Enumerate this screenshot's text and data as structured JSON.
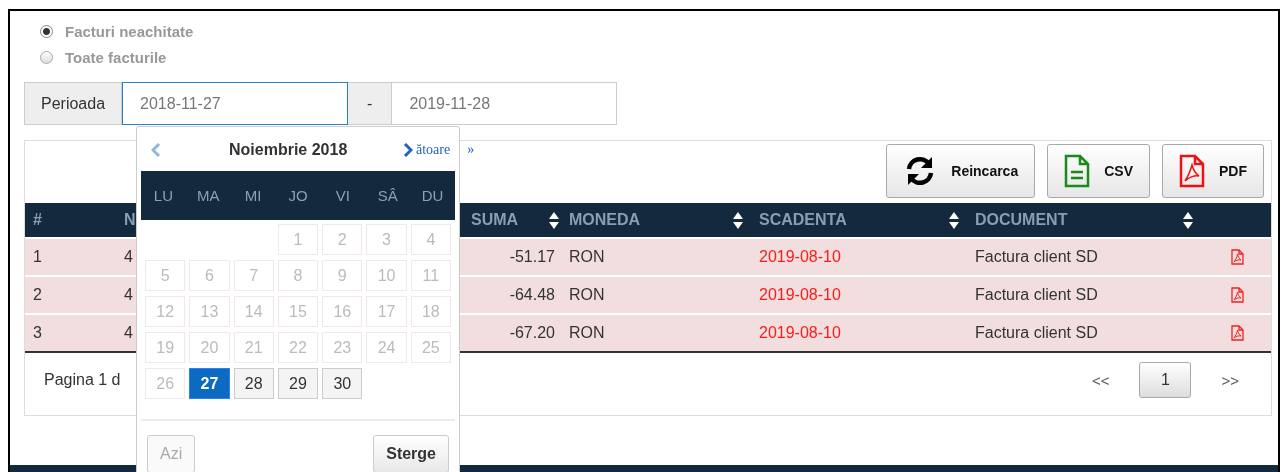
{
  "filter": {
    "options": [
      {
        "label": "Facturi neachitate",
        "selected": true
      },
      {
        "label": "Toate facturile",
        "selected": false
      }
    ]
  },
  "period": {
    "label": "Perioada",
    "from": "2018-11-27",
    "separator": "-",
    "to": "2019-11-28"
  },
  "toolbar": {
    "buttons": [
      {
        "label": "Reincarca",
        "kind": "reload"
      },
      {
        "label": "CSV",
        "kind": "csv"
      },
      {
        "label": "PDF",
        "kind": "pdf"
      }
    ]
  },
  "table": {
    "columns": [
      {
        "label": "#",
        "sortable": false
      },
      {
        "label": "N",
        "sortable": false
      },
      {
        "label": "SUMA",
        "sortable": true
      },
      {
        "label": "MONEDA",
        "sortable": true
      },
      {
        "label": "SCADENTA",
        "sortable": true
      },
      {
        "label": "DOCUMENT",
        "sortable": true
      }
    ],
    "rows": [
      {
        "number": "1",
        "column_2": "4",
        "amount": "-51.17",
        "currency": "RON",
        "due": "2019-08-10",
        "document": "Factura client SD",
        "overdue": true
      },
      {
        "number": "2",
        "column_2": "4",
        "amount": "-64.48",
        "currency": "RON",
        "due": "2019-08-10",
        "document": "Factura client SD",
        "overdue": true
      },
      {
        "number": "3",
        "column_2": "4",
        "amount": "-67.20",
        "currency": "RON",
        "due": "2019-08-10",
        "document": "Factura client SD",
        "overdue": true
      }
    ]
  },
  "pager": {
    "summary": "Pagina 1 d",
    "first": "<<",
    "pages": [
      {
        "label": "1",
        "selected": true
      }
    ],
    "last": ">>"
  },
  "datepicker": {
    "title": "Noiembrie 2018",
    "next_label": "ătoare",
    "next_symbol": "»",
    "weekdays": [
      "LU",
      "MA",
      "MI",
      "JO",
      "VI",
      "SÂ",
      "DU"
    ],
    "weeks": [
      [
        {
          "label": "1",
          "disabled": true,
          "selected": false
        },
        {
          "label": "2",
          "disabled": true,
          "selected": false
        },
        {
          "label": "3",
          "disabled": true,
          "selected": false
        },
        {
          "label": "4",
          "disabled": true,
          "selected": false
        }
      ],
      [
        {
          "label": "5",
          "disabled": true,
          "selected": false
        },
        {
          "label": "6",
          "disabled": true,
          "selected": false
        },
        {
          "label": "7",
          "disabled": true,
          "selected": false
        },
        {
          "label": "8",
          "disabled": true,
          "selected": false
        },
        {
          "label": "9",
          "disabled": true,
          "selected": false
        },
        {
          "label": "10",
          "disabled": true,
          "selected": false
        },
        {
          "label": "11",
          "disabled": true,
          "selected": false
        }
      ],
      [
        {
          "label": "12",
          "disabled": true,
          "selected": false
        },
        {
          "label": "13",
          "disabled": true,
          "selected": false
        },
        {
          "label": "14",
          "disabled": true,
          "selected": false
        },
        {
          "label": "15",
          "disabled": true,
          "selected": false
        },
        {
          "label": "16",
          "disabled": true,
          "selected": false
        },
        {
          "label": "17",
          "disabled": true,
          "selected": false
        },
        {
          "label": "18",
          "disabled": true,
          "selected": false
        }
      ],
      [
        {
          "label": "19",
          "disabled": true,
          "selected": false
        },
        {
          "label": "20",
          "disabled": true,
          "selected": false
        },
        {
          "label": "21",
          "disabled": true,
          "selected": false
        },
        {
          "label": "22",
          "disabled": true,
          "selected": false
        },
        {
          "label": "23",
          "disabled": true,
          "selected": false
        },
        {
          "label": "24",
          "disabled": true,
          "selected": false
        },
        {
          "label": "25",
          "disabled": true,
          "selected": false
        }
      ],
      [
        {
          "label": "26",
          "disabled": true,
          "selected": false
        },
        {
          "label": "27",
          "disabled": false,
          "selected": true
        },
        {
          "label": "28",
          "disabled": false,
          "selected": false
        },
        {
          "label": "29",
          "disabled": false,
          "selected": false
        },
        {
          "label": "30",
          "disabled": false,
          "selected": false
        }
      ]
    ],
    "buttons": [
      {
        "label": "Azi",
        "disabled": true
      },
      {
        "label": "Sterge",
        "disabled": false
      }
    ]
  }
}
